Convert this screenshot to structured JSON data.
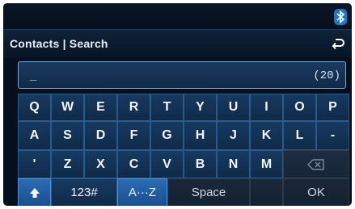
{
  "header": {
    "title": "Contacts | Search",
    "back_icon": "back-arrow-icon"
  },
  "status": {
    "bluetooth_icon": "bluetooth-icon"
  },
  "input": {
    "value": "_",
    "char_count": "(20)"
  },
  "keyboard": {
    "row1": [
      "Q",
      "W",
      "E",
      "R",
      "T",
      "Y",
      "U",
      "I",
      "O",
      "P"
    ],
    "row2": [
      "A",
      "S",
      "D",
      "F",
      "G",
      "H",
      "J",
      "K",
      "L",
      "-"
    ],
    "row3": [
      "'",
      "Z",
      "X",
      "C",
      "V",
      "B",
      "N",
      "M"
    ],
    "backspace_icon": "backspace-icon",
    "shift_icon": "shift-arrow-icon",
    "numeric_label": "123#",
    "alpha_label": "A···Z",
    "space_label": "Space",
    "ok_label": "OK"
  },
  "colors": {
    "accent": "#2a6bb3",
    "key_face": "#173a61",
    "screen_bg": "#05101e"
  }
}
